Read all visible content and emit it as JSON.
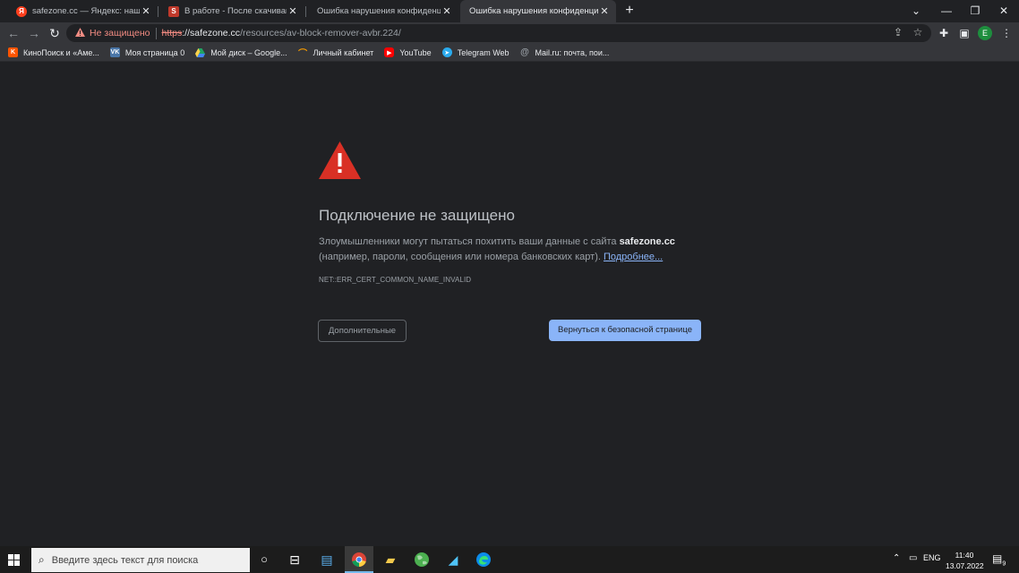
{
  "tabs": [
    {
      "label": "safezone.cc — Яндекс: нашёлся",
      "favicon": "yandex-icon",
      "color": "#fc3f1d"
    },
    {
      "label": "В работе - После скачивания и",
      "favicon": "safezone-icon",
      "color": "#c0392b"
    },
    {
      "label": "Ошибка нарушения конфиденциал",
      "favicon": "none"
    },
    {
      "label": "Ошибка нарушения конфиденциал",
      "favicon": "none",
      "active": true
    }
  ],
  "toolbar": {
    "security_label": "Не защищено",
    "url_scheme": "https",
    "url_host": "://safezone.cc",
    "url_path": "/resources/av-block-remover-avbr.224/",
    "profile_initial": "E"
  },
  "bookmarks": [
    {
      "label": "КиноПоиск и «Аме...",
      "icon": "kinopoisk-icon",
      "color": "#ff5500"
    },
    {
      "label": "Моя страница 0",
      "icon": "vk-icon",
      "color": "#4a76a8"
    },
    {
      "label": "Мой диск – Google...",
      "icon": "google-drive-icon",
      "color": "#1fa463"
    },
    {
      "label": "Личный кабинет",
      "icon": "cabinet-icon",
      "color": "#f29900"
    },
    {
      "label": "YouTube",
      "icon": "youtube-icon",
      "color": "#ff0000"
    },
    {
      "label": "Telegram Web",
      "icon": "telegram-icon",
      "color": "#2aabee"
    },
    {
      "label": "Mail.ru: почта, пои...",
      "icon": "mailru-icon",
      "color": "#168de2"
    }
  ],
  "interstitial": {
    "heading": "Подключение не защищено",
    "explain_part1": "Злоумышленники могут пытаться похитить ваши данные с сайта ",
    "explain_host": "safezone.cc",
    "explain_part2": " (например, пароли, сообщения или номера банковских карт). ",
    "learn_more": "Подробнее...",
    "error_code": "NET::ERR_CERT_COMMON_NAME_INVALID",
    "advanced_button": "Дополнительные",
    "back_button": "Вернуться к безопасной странице"
  },
  "taskbar": {
    "search_placeholder": "Введите здесь текст для поиска",
    "language": "ENG",
    "time": "11:40",
    "date": "13.07.2022",
    "notifications_count": "9"
  },
  "colors": {
    "warning_red": "#d93025",
    "link_blue": "#8ab4f8",
    "page_bg": "#202124"
  }
}
